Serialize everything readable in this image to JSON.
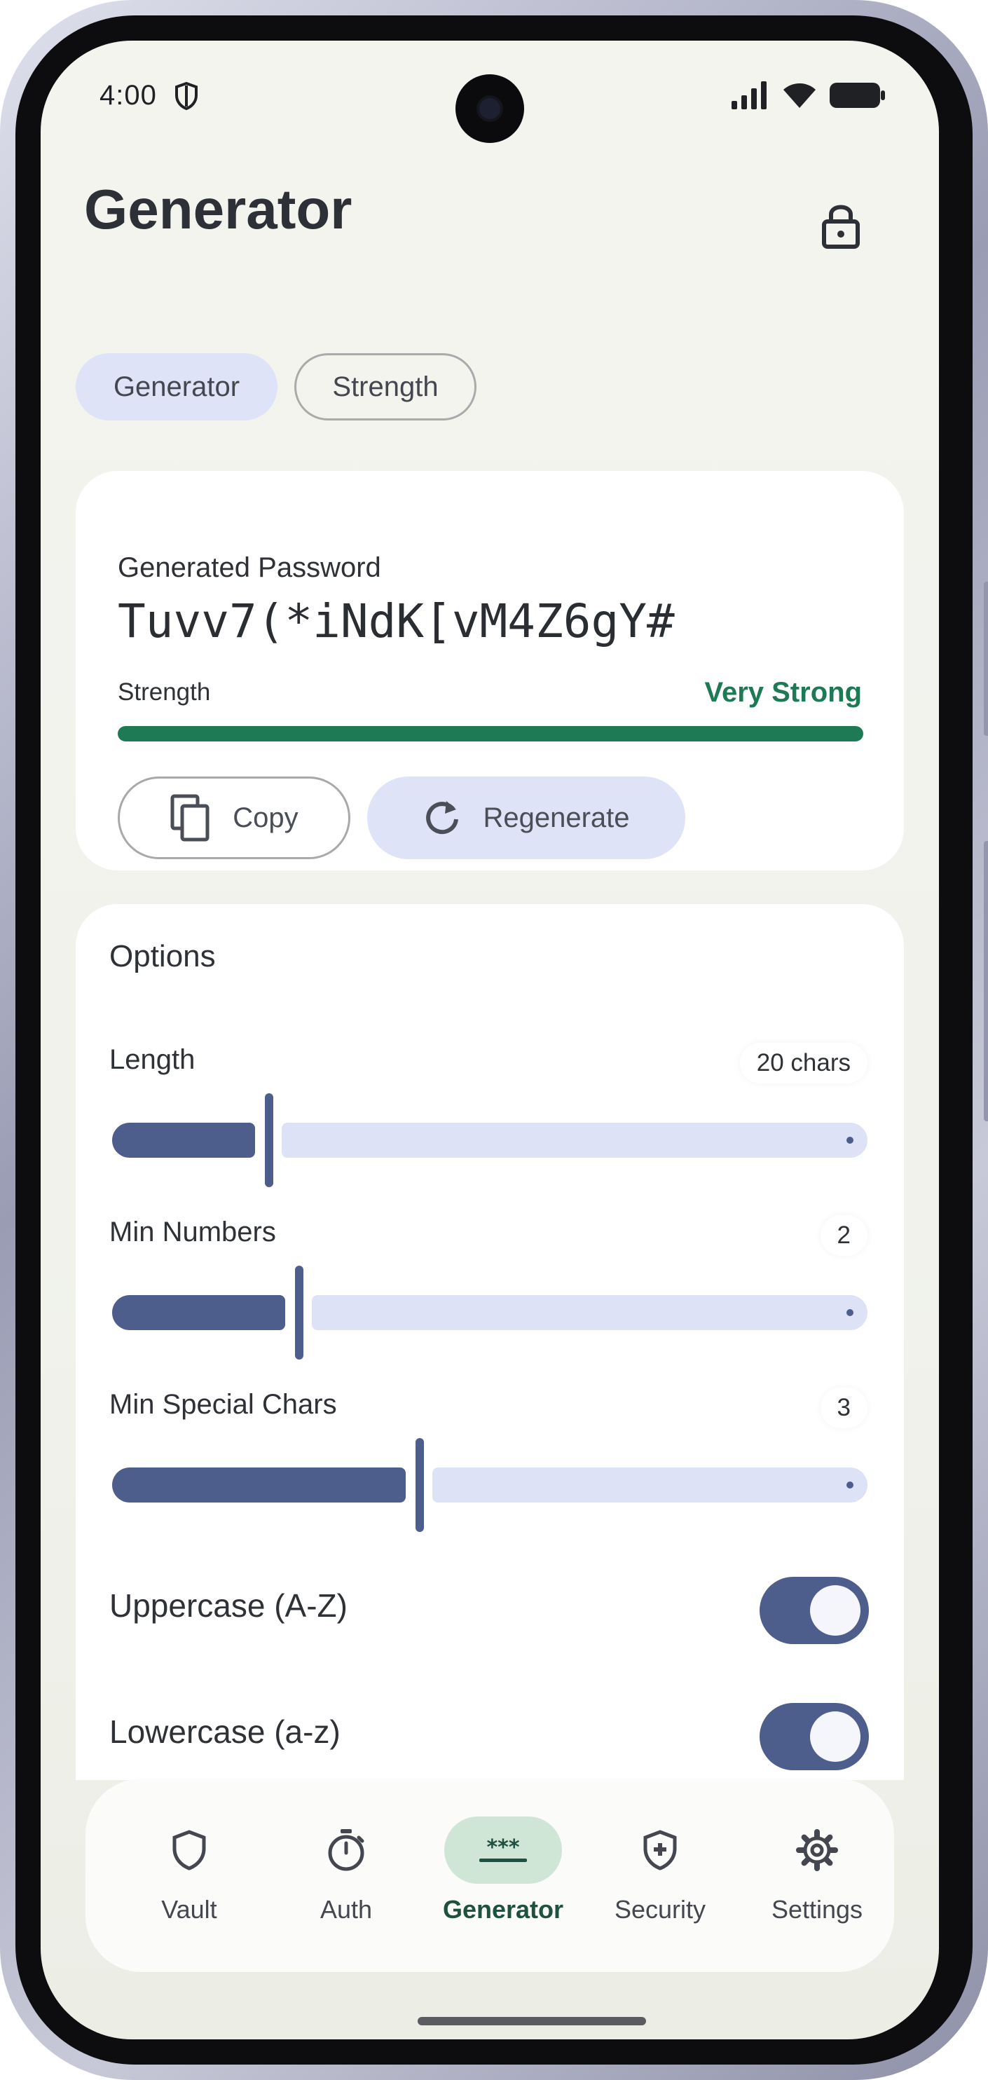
{
  "status_bar": {
    "time": "4:00"
  },
  "header": {
    "title": "Generator"
  },
  "tabs": [
    {
      "label": "Generator",
      "active": true
    },
    {
      "label": "Strength",
      "active": false
    }
  ],
  "password_card": {
    "label": "Generated Password",
    "password": "Tuvv7(*iNdK[vM4Z6gY#",
    "strength_label": "Strength",
    "strength_value": "Very Strong",
    "strength_fraction": 1.0,
    "copy_label": "Copy",
    "regenerate_label": "Regenerate"
  },
  "options": {
    "title": "Options",
    "sliders": [
      {
        "label": "Length",
        "value": "20 chars",
        "fraction": 0.2
      },
      {
        "label": "Min Numbers",
        "value": "2",
        "fraction": 0.24
      },
      {
        "label": "Min Special Chars",
        "value": "3",
        "fraction": 0.4
      }
    ],
    "toggles": [
      {
        "label": "Uppercase (A-Z)",
        "on": true
      },
      {
        "label": "Lowercase (a-z)",
        "on": true
      }
    ]
  },
  "bottom_nav": {
    "items": [
      {
        "label": "Vault",
        "icon": "shield-icon",
        "active": false
      },
      {
        "label": "Auth",
        "icon": "timer-icon",
        "active": false
      },
      {
        "label": "Generator",
        "icon": "password-icon",
        "active": true
      },
      {
        "label": "Security",
        "icon": "security-shield-plus-icon",
        "active": false
      },
      {
        "label": "Settings",
        "icon": "gear-icon",
        "active": false
      }
    ]
  },
  "colors": {
    "accent": "#4e5e8c",
    "strength_green": "#1e7a55",
    "chip_bg": "#dfe3f8",
    "active_nav_bg": "#cfe6d7"
  }
}
